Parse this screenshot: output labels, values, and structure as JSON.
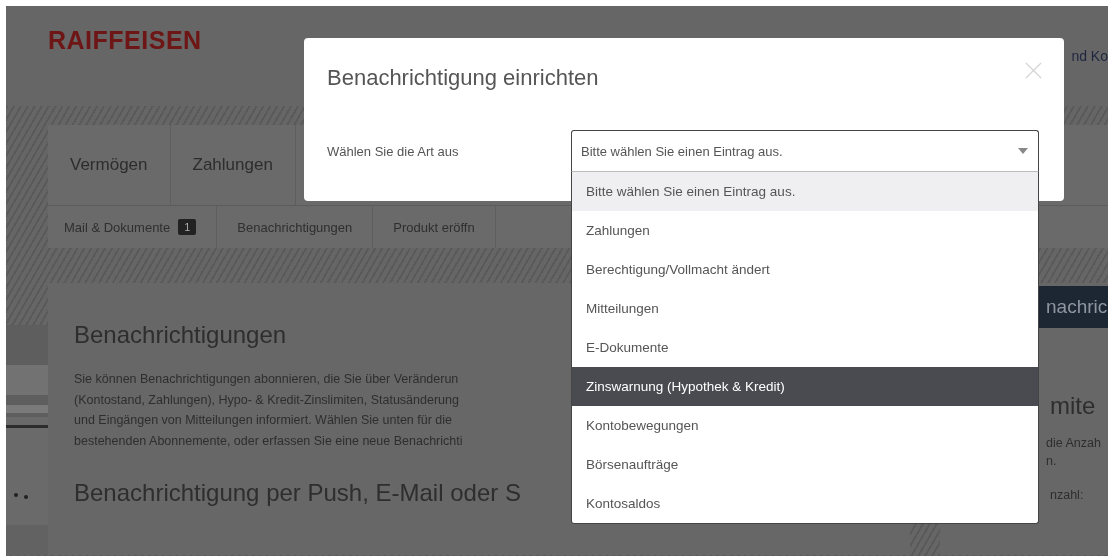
{
  "header": {
    "logo": "RAIFFEISEN",
    "top_link": "nd Ko"
  },
  "nav": [
    {
      "label": "Vermögen"
    },
    {
      "label": "Zahlungen"
    }
  ],
  "subnav": [
    {
      "label": "Mail & Dokumente",
      "badge": "1"
    },
    {
      "label": "Benachrichtigungen"
    },
    {
      "label": "Produkt eröffn"
    }
  ],
  "content": {
    "title": "Benachrichtigungen",
    "paragraph_lines": [
      "Sie können Benachrichtigungen abonnieren, die Sie über Veränderun",
      "(Kontostand, Zahlungen), Hypo- & Kredit-Zinslimiten, Statusänderung",
      "und Eingängen von Mitteilungen informiert. Wählen Sie unten für die",
      "bestehenden Abonnemente, oder erfassen Sie eine neue Benachrichti"
    ],
    "subtitle": "Benachrichtigung per Push, E-Mail oder S"
  },
  "side": {
    "button": "nachric",
    "title": "mite",
    "text_lines": [
      "die Anzah",
      "n."
    ],
    "label": "nzahl:"
  },
  "modal": {
    "title": "Benachrichtigung einrichten",
    "field_label": "Wählen Sie die Art aus",
    "select": {
      "value": "Bitte wählen Sie einen Eintrag aus.",
      "expanded": true
    },
    "options": [
      {
        "label": "Bitte wählen Sie einen Eintrag aus.",
        "selected": true,
        "highlighted": false
      },
      {
        "label": "Zahlungen",
        "selected": false,
        "highlighted": false
      },
      {
        "label": "Berechtigung/Vollmacht ändert",
        "selected": false,
        "highlighted": false
      },
      {
        "label": "Mitteilungen",
        "selected": false,
        "highlighted": false
      },
      {
        "label": "E-Dokumente",
        "selected": false,
        "highlighted": false
      },
      {
        "label": "Zinswarnung (Hypothek & Kredit)",
        "selected": false,
        "highlighted": true
      },
      {
        "label": "Kontobewegungen",
        "selected": false,
        "highlighted": false
      },
      {
        "label": "Börsenaufträge",
        "selected": false,
        "highlighted": false
      },
      {
        "label": "Kontosaldos",
        "selected": false,
        "highlighted": false
      }
    ]
  }
}
